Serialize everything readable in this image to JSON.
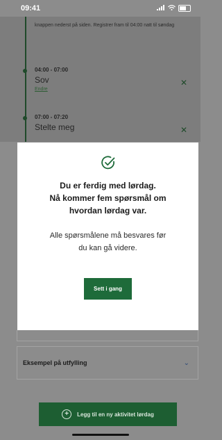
{
  "status_bar": {
    "time": "09:41",
    "signal": "📶",
    "wifi": "📶"
  },
  "timeline": {
    "intro": "knappen nederst på siden. Registrer fram til 04:00 natt til søndag",
    "entries": [
      {
        "time": "04:00 - 07:00",
        "title": "Sov",
        "link": "Endre"
      },
      {
        "time": "07:00 - 07:20",
        "title": "Stelte meg"
      }
    ],
    "remove_glyph": "✕"
  },
  "modal": {
    "icon": "check-circle-icon",
    "title_line1": "Du er ferdig med lørdag.",
    "title_line2": "Nå kommer fem spørsmål om",
    "title_line3": "hvordan lørdag var.",
    "body_line1": "Alle spørsmålene må besvares før",
    "body_line2": "du kan gå videre.",
    "button": "Sett i gang"
  },
  "example": {
    "label": "Eksempel på utfylling",
    "chevron": "⌄"
  },
  "add_activity": {
    "label": "Legg til en ny aktivitet lørdag",
    "plus": "+"
  },
  "colors": {
    "primary": "#1e6b3a",
    "overlay": "#8c8c8c"
  }
}
